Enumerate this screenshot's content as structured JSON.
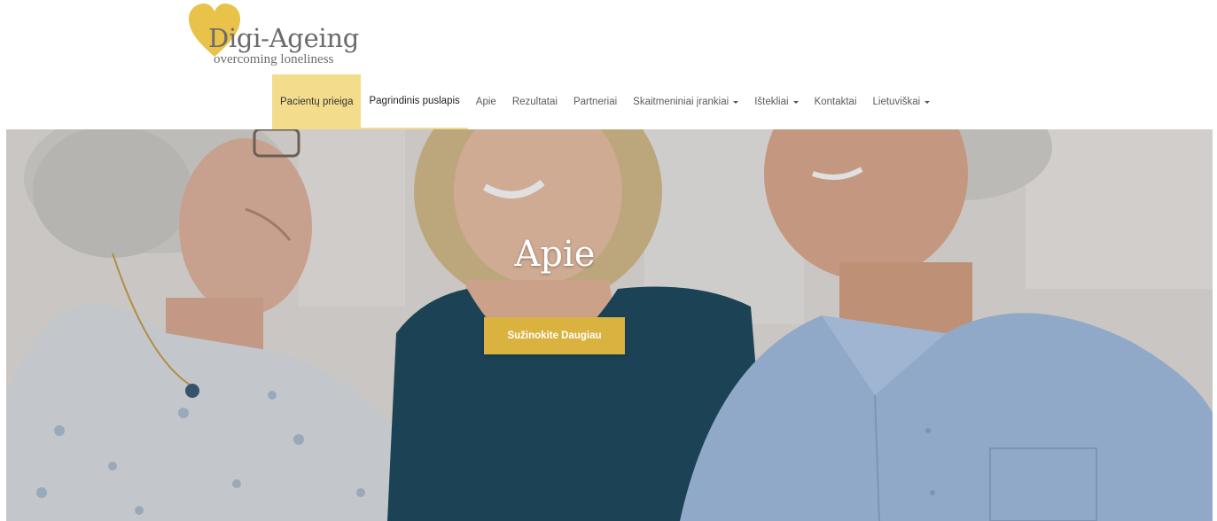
{
  "logo": {
    "title": "Digi-Ageing",
    "tagline": "overcoming loneliness"
  },
  "nav": {
    "items": [
      {
        "label": "Pacientų prieiga",
        "has_dropdown": false
      },
      {
        "label": "Pagrindinis puslapis",
        "has_dropdown": false
      },
      {
        "label": "Apie",
        "has_dropdown": false
      },
      {
        "label": "Rezultatai",
        "has_dropdown": false
      },
      {
        "label": "Partneriai",
        "has_dropdown": false
      },
      {
        "label": "Skaitmeniniai įrankiai",
        "has_dropdown": true
      },
      {
        "label": "Ištekliai",
        "has_dropdown": true
      },
      {
        "label": "Kontaktai",
        "has_dropdown": false
      },
      {
        "label": "Lietuviškai",
        "has_dropdown": true
      }
    ]
  },
  "hero": {
    "title": "Apie",
    "button_label": "Sužinokite Daugiau"
  },
  "colors": {
    "accent_yellow": "#f3dd8d",
    "button_gold": "#d9b23f",
    "heart_yellow": "#e9c24a"
  }
}
